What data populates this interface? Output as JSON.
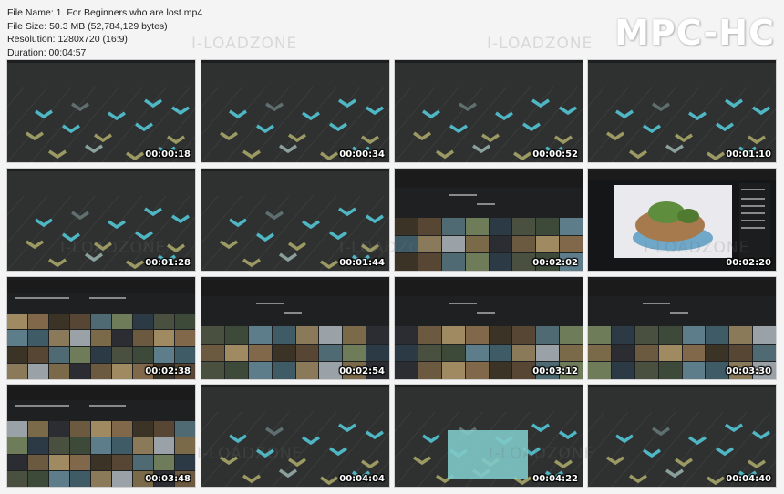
{
  "file_info": {
    "file_name": "File Name: 1. For Beginners who are lost.mp4",
    "file_size": "File Size: 50.3 MB (52,784,129 bytes)",
    "resolution": "Resolution: 1280x720 (16:9)",
    "duration": "Duration: 00:04:57"
  },
  "brand": "MPC-HC",
  "watermark": "I-LOADZONE",
  "colors": {
    "thumb_bg": "#2f3030",
    "accent_teal": "#4fb6c4",
    "accent_olive": "#9c9a63",
    "overlay_teal": "#7fc9c8"
  },
  "thumbnails": [
    {
      "time": "00:00:18",
      "kind": "pattern"
    },
    {
      "time": "00:00:34",
      "kind": "pattern"
    },
    {
      "time": "00:00:52",
      "kind": "pattern"
    },
    {
      "time": "00:01:10",
      "kind": "pattern"
    },
    {
      "time": "00:01:28",
      "kind": "pattern"
    },
    {
      "time": "00:01:44",
      "kind": "pattern"
    },
    {
      "time": "00:02:02",
      "kind": "library"
    },
    {
      "time": "00:02:20",
      "kind": "detail"
    },
    {
      "time": "00:02:38",
      "kind": "browser"
    },
    {
      "time": "00:02:54",
      "kind": "library"
    },
    {
      "time": "00:03:12",
      "kind": "library"
    },
    {
      "time": "00:03:30",
      "kind": "library"
    },
    {
      "time": "00:03:48",
      "kind": "browser"
    },
    {
      "time": "00:04:04",
      "kind": "pattern"
    },
    {
      "time": "00:04:22",
      "kind": "overlay"
    },
    {
      "time": "00:04:40",
      "kind": "pattern"
    }
  ]
}
